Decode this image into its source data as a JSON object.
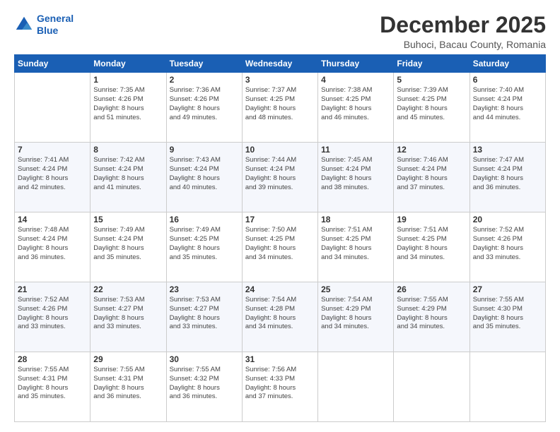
{
  "logo": {
    "line1": "General",
    "line2": "Blue"
  },
  "title": "December 2025",
  "subtitle": "Buhoci, Bacau County, Romania",
  "weekdays": [
    "Sunday",
    "Monday",
    "Tuesday",
    "Wednesday",
    "Thursday",
    "Friday",
    "Saturday"
  ],
  "weeks": [
    [
      {
        "day": "",
        "info": ""
      },
      {
        "day": "1",
        "info": "Sunrise: 7:35 AM\nSunset: 4:26 PM\nDaylight: 8 hours\nand 51 minutes."
      },
      {
        "day": "2",
        "info": "Sunrise: 7:36 AM\nSunset: 4:26 PM\nDaylight: 8 hours\nand 49 minutes."
      },
      {
        "day": "3",
        "info": "Sunrise: 7:37 AM\nSunset: 4:25 PM\nDaylight: 8 hours\nand 48 minutes."
      },
      {
        "day": "4",
        "info": "Sunrise: 7:38 AM\nSunset: 4:25 PM\nDaylight: 8 hours\nand 46 minutes."
      },
      {
        "day": "5",
        "info": "Sunrise: 7:39 AM\nSunset: 4:25 PM\nDaylight: 8 hours\nand 45 minutes."
      },
      {
        "day": "6",
        "info": "Sunrise: 7:40 AM\nSunset: 4:24 PM\nDaylight: 8 hours\nand 44 minutes."
      }
    ],
    [
      {
        "day": "7",
        "info": "Sunrise: 7:41 AM\nSunset: 4:24 PM\nDaylight: 8 hours\nand 42 minutes."
      },
      {
        "day": "8",
        "info": "Sunrise: 7:42 AM\nSunset: 4:24 PM\nDaylight: 8 hours\nand 41 minutes."
      },
      {
        "day": "9",
        "info": "Sunrise: 7:43 AM\nSunset: 4:24 PM\nDaylight: 8 hours\nand 40 minutes."
      },
      {
        "day": "10",
        "info": "Sunrise: 7:44 AM\nSunset: 4:24 PM\nDaylight: 8 hours\nand 39 minutes."
      },
      {
        "day": "11",
        "info": "Sunrise: 7:45 AM\nSunset: 4:24 PM\nDaylight: 8 hours\nand 38 minutes."
      },
      {
        "day": "12",
        "info": "Sunrise: 7:46 AM\nSunset: 4:24 PM\nDaylight: 8 hours\nand 37 minutes."
      },
      {
        "day": "13",
        "info": "Sunrise: 7:47 AM\nSunset: 4:24 PM\nDaylight: 8 hours\nand 36 minutes."
      }
    ],
    [
      {
        "day": "14",
        "info": "Sunrise: 7:48 AM\nSunset: 4:24 PM\nDaylight: 8 hours\nand 36 minutes."
      },
      {
        "day": "15",
        "info": "Sunrise: 7:49 AM\nSunset: 4:24 PM\nDaylight: 8 hours\nand 35 minutes."
      },
      {
        "day": "16",
        "info": "Sunrise: 7:49 AM\nSunset: 4:25 PM\nDaylight: 8 hours\nand 35 minutes."
      },
      {
        "day": "17",
        "info": "Sunrise: 7:50 AM\nSunset: 4:25 PM\nDaylight: 8 hours\nand 34 minutes."
      },
      {
        "day": "18",
        "info": "Sunrise: 7:51 AM\nSunset: 4:25 PM\nDaylight: 8 hours\nand 34 minutes."
      },
      {
        "day": "19",
        "info": "Sunrise: 7:51 AM\nSunset: 4:25 PM\nDaylight: 8 hours\nand 34 minutes."
      },
      {
        "day": "20",
        "info": "Sunrise: 7:52 AM\nSunset: 4:26 PM\nDaylight: 8 hours\nand 33 minutes."
      }
    ],
    [
      {
        "day": "21",
        "info": "Sunrise: 7:52 AM\nSunset: 4:26 PM\nDaylight: 8 hours\nand 33 minutes."
      },
      {
        "day": "22",
        "info": "Sunrise: 7:53 AM\nSunset: 4:27 PM\nDaylight: 8 hours\nand 33 minutes."
      },
      {
        "day": "23",
        "info": "Sunrise: 7:53 AM\nSunset: 4:27 PM\nDaylight: 8 hours\nand 33 minutes."
      },
      {
        "day": "24",
        "info": "Sunrise: 7:54 AM\nSunset: 4:28 PM\nDaylight: 8 hours\nand 34 minutes."
      },
      {
        "day": "25",
        "info": "Sunrise: 7:54 AM\nSunset: 4:29 PM\nDaylight: 8 hours\nand 34 minutes."
      },
      {
        "day": "26",
        "info": "Sunrise: 7:55 AM\nSunset: 4:29 PM\nDaylight: 8 hours\nand 34 minutes."
      },
      {
        "day": "27",
        "info": "Sunrise: 7:55 AM\nSunset: 4:30 PM\nDaylight: 8 hours\nand 35 minutes."
      }
    ],
    [
      {
        "day": "28",
        "info": "Sunrise: 7:55 AM\nSunset: 4:31 PM\nDaylight: 8 hours\nand 35 minutes."
      },
      {
        "day": "29",
        "info": "Sunrise: 7:55 AM\nSunset: 4:31 PM\nDaylight: 8 hours\nand 36 minutes."
      },
      {
        "day": "30",
        "info": "Sunrise: 7:55 AM\nSunset: 4:32 PM\nDaylight: 8 hours\nand 36 minutes."
      },
      {
        "day": "31",
        "info": "Sunrise: 7:56 AM\nSunset: 4:33 PM\nDaylight: 8 hours\nand 37 minutes."
      },
      {
        "day": "",
        "info": ""
      },
      {
        "day": "",
        "info": ""
      },
      {
        "day": "",
        "info": ""
      }
    ]
  ]
}
